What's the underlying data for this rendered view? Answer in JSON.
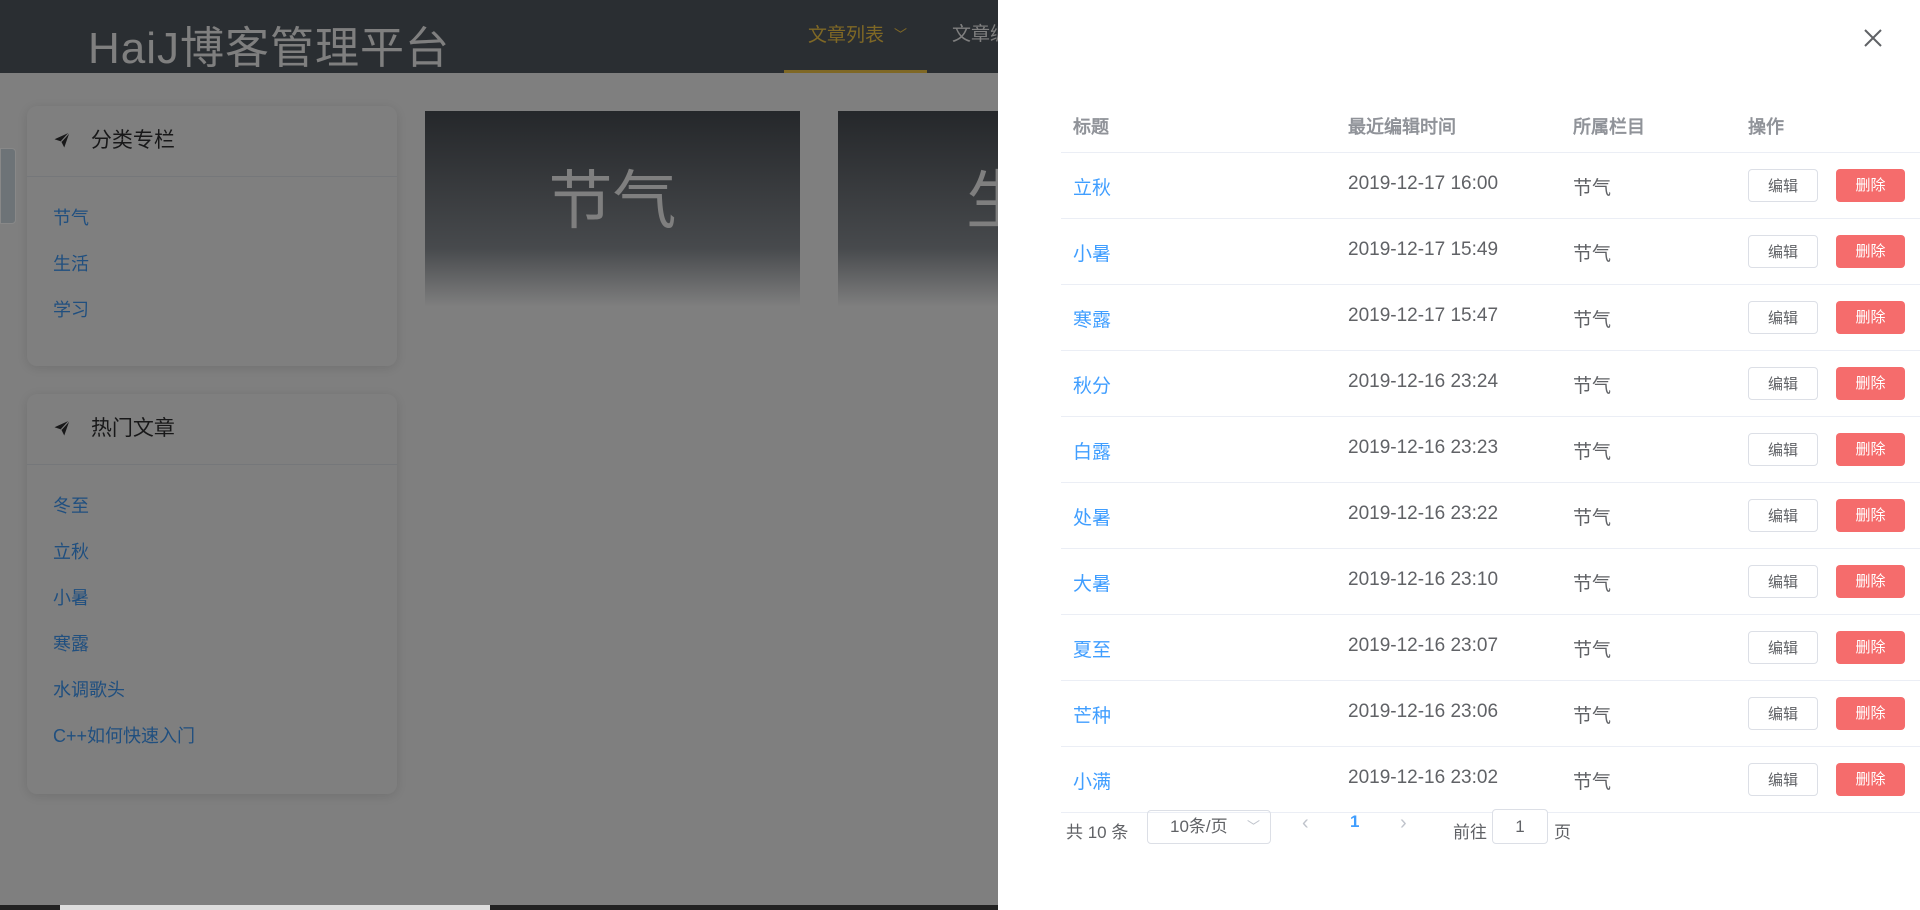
{
  "header": {
    "brand": "HaiJ博客管理平台",
    "nav": [
      {
        "label": "文章列表",
        "active": true
      },
      {
        "label": "文章编"
      }
    ]
  },
  "sidebar": {
    "categories": {
      "title": "分类专栏",
      "items": [
        "节气",
        "生活",
        "学习"
      ]
    },
    "hot": {
      "title": "热门文章",
      "items": [
        "冬至",
        "立秋",
        "小暑",
        "寒露",
        "水调歌头",
        "C++如何快速入门"
      ]
    }
  },
  "tiles": [
    "节气",
    "生"
  ],
  "drawer": {
    "table": {
      "headers": {
        "title": "标题",
        "time": "最近编辑时间",
        "column": "所属栏目",
        "ops": "操作"
      },
      "edit_label": "编辑",
      "delete_label": "删除",
      "rows": [
        {
          "title": "立秋",
          "time": "2019-12-17 16:00",
          "column": "节气"
        },
        {
          "title": "小暑",
          "time": "2019-12-17 15:49",
          "column": "节气"
        },
        {
          "title": "寒露",
          "time": "2019-12-17 15:47",
          "column": "节气"
        },
        {
          "title": "秋分",
          "time": "2019-12-16 23:24",
          "column": "节气"
        },
        {
          "title": "白露",
          "time": "2019-12-16 23:23",
          "column": "节气"
        },
        {
          "title": "处暑",
          "time": "2019-12-16 23:22",
          "column": "节气"
        },
        {
          "title": "大暑",
          "time": "2019-12-16 23:10",
          "column": "节气"
        },
        {
          "title": "夏至",
          "time": "2019-12-16 23:07",
          "column": "节气"
        },
        {
          "title": "芒种",
          "time": "2019-12-16 23:06",
          "column": "节气"
        },
        {
          "title": "小满",
          "time": "2019-12-16 23:02",
          "column": "节气"
        }
      ]
    },
    "pagination": {
      "total_text": "共 10 条",
      "page_size": "10条/页",
      "current_page": "1",
      "goto_prefix": "前往",
      "goto_value": "1",
      "goto_suffix": "页"
    }
  },
  "colors": {
    "accent": "#409eff",
    "danger": "#f56c6c",
    "nav_active": "#ffd04b",
    "header_bg": "#545c64"
  }
}
